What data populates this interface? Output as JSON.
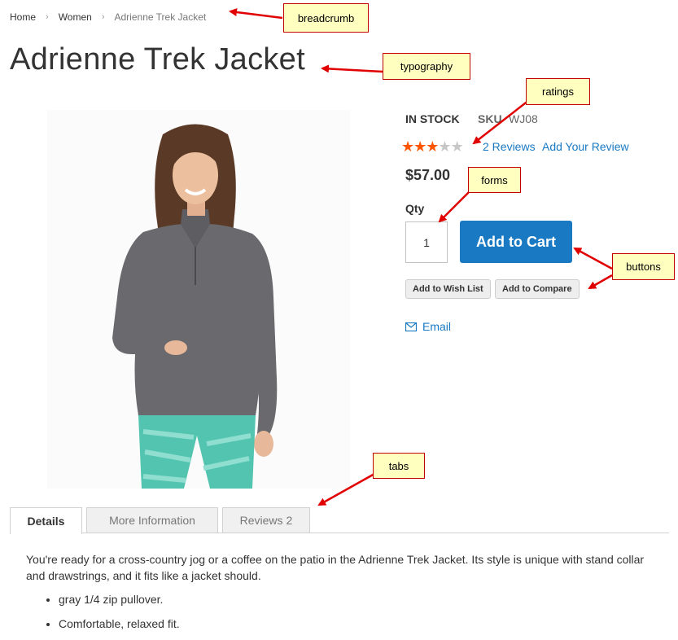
{
  "breadcrumb": {
    "items": [
      "Home",
      "Women"
    ],
    "current": "Adrienne Trek Jacket",
    "separator": "›"
  },
  "product": {
    "title": "Adrienne Trek Jacket",
    "stock": "IN STOCK",
    "sku_label": "SKU",
    "sku": "WJ08",
    "rating": {
      "value": 3,
      "max": 5
    },
    "reviews_link": "2 Reviews",
    "add_review_link": "Add Your Review",
    "price": "$57.00",
    "qty_label": "Qty",
    "qty": "1",
    "add_to_cart": "Add to Cart",
    "wish_list": "Add to Wish List",
    "compare": "Add to Compare",
    "email": "Email"
  },
  "tabs": [
    {
      "label": "Details",
      "active": true,
      "count": ""
    },
    {
      "label": "More Information",
      "active": false,
      "count": ""
    },
    {
      "label": "Reviews",
      "active": false,
      "count": "2"
    }
  ],
  "details": {
    "description": "You're ready for a cross-country jog or a coffee on the patio in the Adrienne Trek Jacket. Its style is unique with stand collar and drawstrings, and it fits like a jacket should.",
    "bullets": [
      "gray 1/4 zip pullover.",
      "Comfortable, relaxed fit."
    ]
  },
  "annotations": {
    "breadcrumb": "breadcrumb",
    "typography": "typography",
    "ratings": "ratings",
    "forms": "forms",
    "buttons": "buttons",
    "tabs": "tabs"
  },
  "colors": {
    "accent": "#1979c3",
    "star_on": "#ff5501",
    "star_off": "#c7c7c7",
    "note_bg": "#ffffc0",
    "note_border": "#c40000",
    "arrow": "#e00000"
  }
}
